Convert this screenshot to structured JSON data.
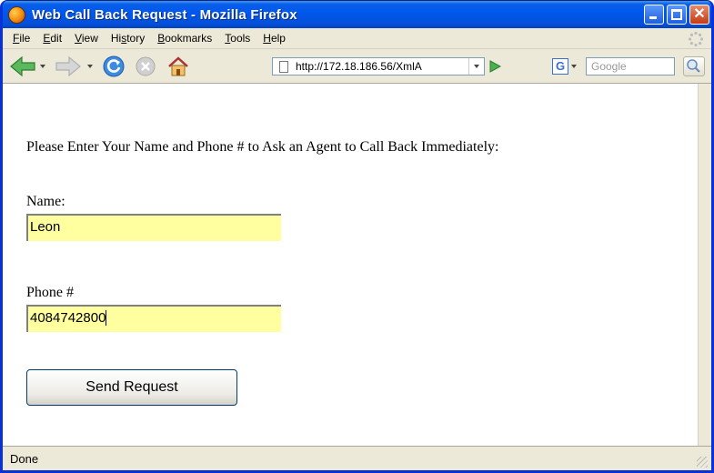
{
  "window": {
    "title": "Web Call Back Request - Mozilla Firefox",
    "close_glyph": "✕"
  },
  "menu": {
    "items": [
      {
        "label": "File",
        "accel": "F",
        "rest": "ile"
      },
      {
        "label": "Edit",
        "accel": "E",
        "rest": "dit"
      },
      {
        "label": "View",
        "accel": "V",
        "rest": "iew"
      },
      {
        "label": "History",
        "pre": "Hi",
        "accel": "s",
        "rest": "tory"
      },
      {
        "label": "Bookmarks",
        "accel": "B",
        "rest": "ookmarks"
      },
      {
        "label": "Tools",
        "accel": "T",
        "rest": "ools"
      },
      {
        "label": "Help",
        "accel": "H",
        "rest": "elp"
      }
    ]
  },
  "toolbar": {
    "url": "http://172.18.186.56/XmlA",
    "search_engine_glyph": "G",
    "search_placeholder": "Google"
  },
  "page": {
    "prompt": "Please Enter Your Name and Phone #  to Ask an Agent to Call Back Immediately:",
    "name_label": "Name:",
    "name_value": "Leon",
    "phone_label": "Phone #",
    "phone_value": "4084742800",
    "submit_label": "Send Request"
  },
  "status": {
    "text": "Done"
  },
  "colors": {
    "titlebar": "#0058ee",
    "field_bg": "#ffffa0",
    "chrome": "#ece9d8"
  }
}
